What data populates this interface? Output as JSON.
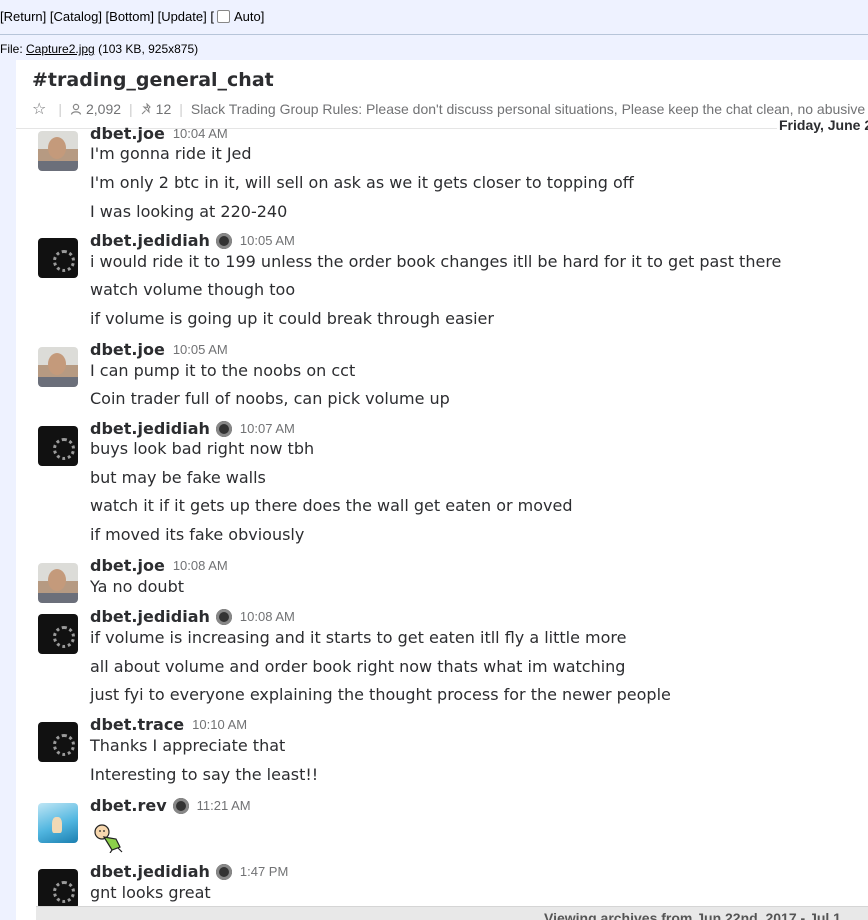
{
  "nav": {
    "return": "Return",
    "catalog": "Catalog",
    "bottom": "Bottom",
    "update": "Update",
    "auto": "Auto"
  },
  "file": {
    "prefix": "File:",
    "name": "Capture2.jpg",
    "details": "(103 KB, 925x875)"
  },
  "channel": {
    "title": "#trading_general_chat",
    "members": "2,092",
    "pins": "12",
    "topic": "Slack Trading Group Rules: Please don't discuss personal situations,  Please keep the chat clean, no abusive"
  },
  "date_divider": "Friday, June 2",
  "messages": [
    {
      "user": "dbet.joe",
      "time": "10:04 AM",
      "lines": [
        "I'm gonna ride it Jed",
        "I'm only 2 btc in it, will sell on ask as we it gets closer to topping off",
        "I was looking at 220-240"
      ]
    },
    {
      "user": "dbet.jedidiah",
      "time": "10:05 AM",
      "lines": [
        "i would ride it to 199 unless the order book changes itll be hard for it to get past there",
        "watch volume though too",
        "if volume is going up it could break through easier"
      ]
    },
    {
      "user": "dbet.joe",
      "time": "10:05 AM",
      "lines": [
        "I can pump it to the noobs on cct",
        "Coin trader full of noobs, can pick volume up"
      ]
    },
    {
      "user": "dbet.jedidiah",
      "time": "10:07 AM",
      "lines": [
        "buys look bad right now tbh",
        "but may be fake walls",
        "watch it if it gets up there does the wall get eaten or moved",
        "if moved its fake obviously"
      ]
    },
    {
      "user": "dbet.joe",
      "time": "10:08 AM",
      "lines": [
        "Ya no doubt"
      ]
    },
    {
      "user": "dbet.jedidiah",
      "time": "10:08 AM",
      "lines": [
        "if volume is increasing and it starts to get eaten itll fly a little more",
        "all about volume and order book right now thats what im watching",
        "just fyi to everyone explaining the thought process for the newer people"
      ]
    },
    {
      "user": "dbet.trace",
      "time": "10:10 AM",
      "lines": [
        "Thanks I appreciate that",
        "Interesting to say the least!!"
      ]
    },
    {
      "user": "dbet.rev",
      "time": "11:21 AM",
      "lines": []
    },
    {
      "user": "dbet.jedidiah",
      "time": "1:47 PM",
      "lines": [
        "gnt looks great"
      ]
    }
  ],
  "archive": "Viewing archives from Jun 22nd, 2017 - Jul 1"
}
